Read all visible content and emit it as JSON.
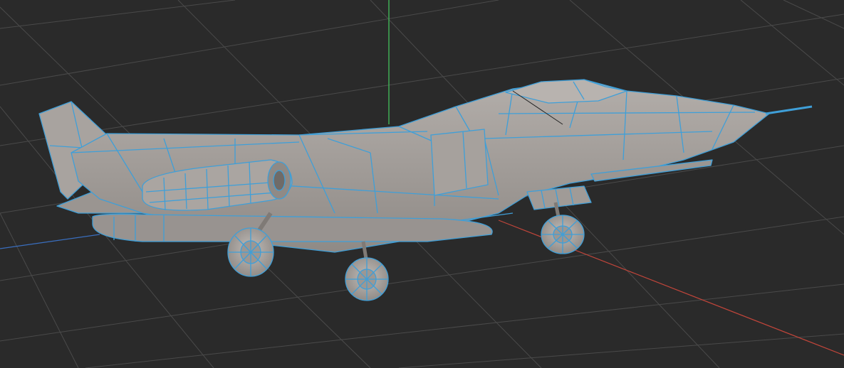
{
  "viewport": {
    "background": "#2a2a2a",
    "grid_color": "#4a4a4a",
    "axis_x_color": "#c0453a",
    "axis_y_color": "#3fae54",
    "axis_z_color": "#3a6fc0",
    "mesh_fill": "#a29d99",
    "mesh_shade": "#8e8985",
    "mesh_wire": "#3f9fd8"
  },
  "model": {
    "object": "jet-aircraft",
    "display_mode": "wireframe-on-shaded",
    "selected": true
  }
}
